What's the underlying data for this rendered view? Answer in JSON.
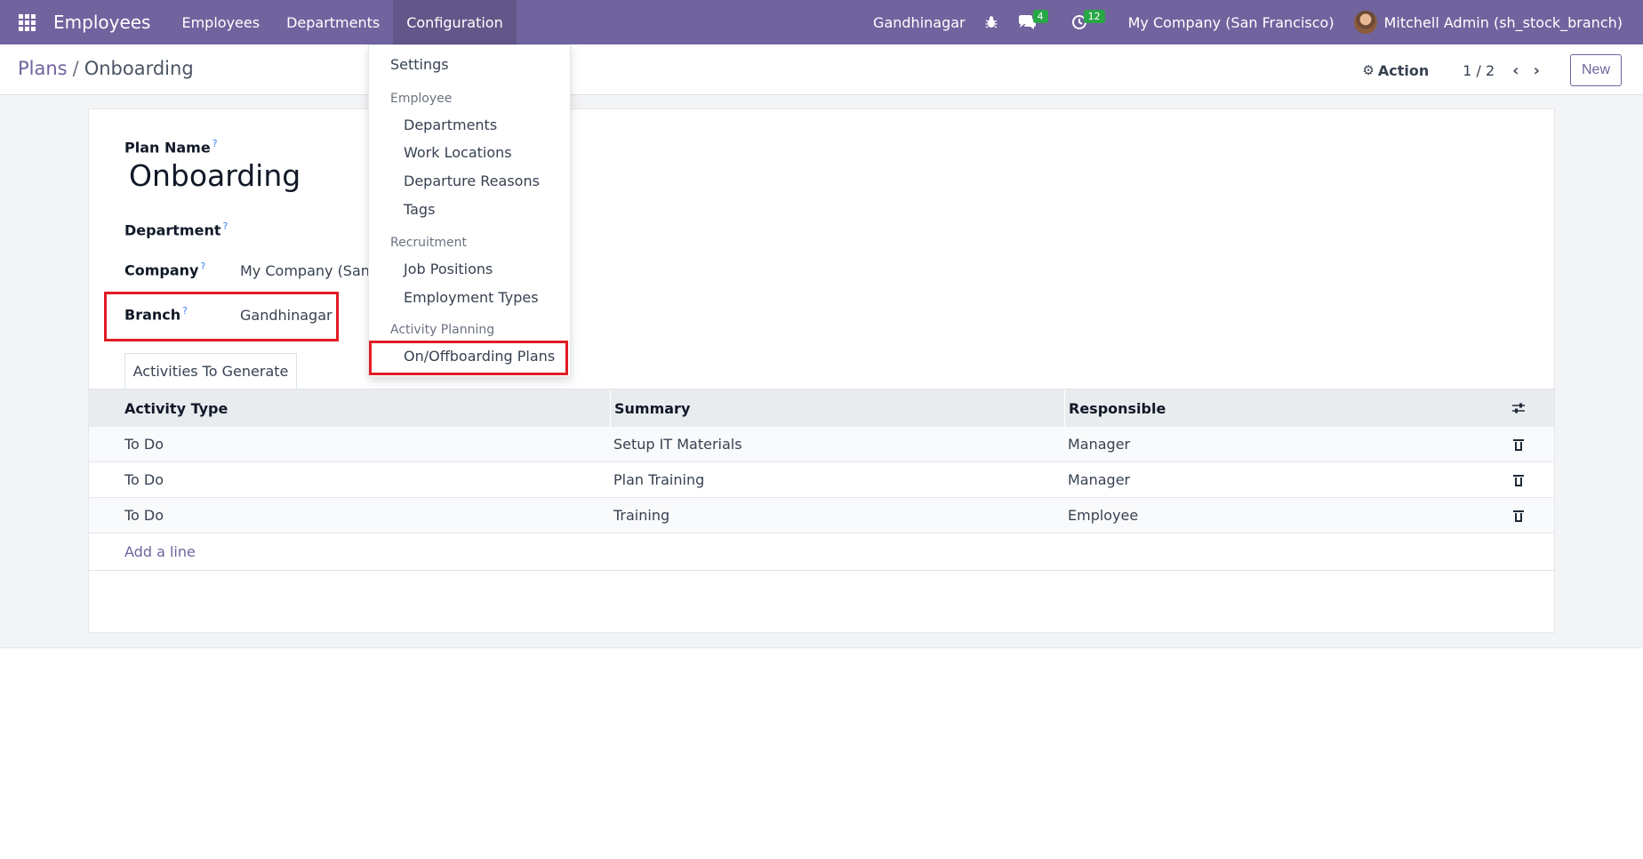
{
  "navbar": {
    "app_title": "Employees",
    "menu": [
      "Employees",
      "Departments",
      "Configuration"
    ],
    "branch": "Gandhinagar",
    "messages_count": "4",
    "activities_count": "12",
    "company": "My Company (San Francisco)",
    "user": "Mitchell Admin (sh_stock_branch)"
  },
  "breadcrumb": {
    "parent": "Plans",
    "separator": "/",
    "current": "Onboarding"
  },
  "control": {
    "action_label": "Action",
    "pager": "1 / 2",
    "new_label": "New"
  },
  "form": {
    "plan_name_label": "Plan Name",
    "plan_name": "Onboarding",
    "department_label": "Department",
    "company_label": "Company",
    "company_value": "My Company (San F",
    "branch_label": "Branch",
    "branch_value": "Gandhinagar",
    "help_mark": "?"
  },
  "tabs": {
    "activities": "Activities To Generate"
  },
  "table": {
    "headers": [
      "Activity Type",
      "Summary",
      "Responsible"
    ],
    "rows": [
      {
        "type": "To Do",
        "summary": "Setup IT Materials",
        "responsible": "Manager"
      },
      {
        "type": "To Do",
        "summary": "Plan Training",
        "responsible": "Manager"
      },
      {
        "type": "To Do",
        "summary": "Training",
        "responsible": "Employee"
      }
    ],
    "add_line": "Add a line"
  },
  "dropdown": {
    "settings": "Settings",
    "employee_header": "Employee",
    "departments": "Departments",
    "work_locations": "Work Locations",
    "departure_reasons": "Departure Reasons",
    "tags": "Tags",
    "recruitment_header": "Recruitment",
    "job_positions": "Job Positions",
    "employment_types": "Employment Types",
    "activity_planning_header": "Activity Planning",
    "plans": "On/Offboarding Plans"
  },
  "colors": {
    "navbar": "#71639e",
    "highlight": "#e11d24",
    "badge": "#28a745"
  }
}
